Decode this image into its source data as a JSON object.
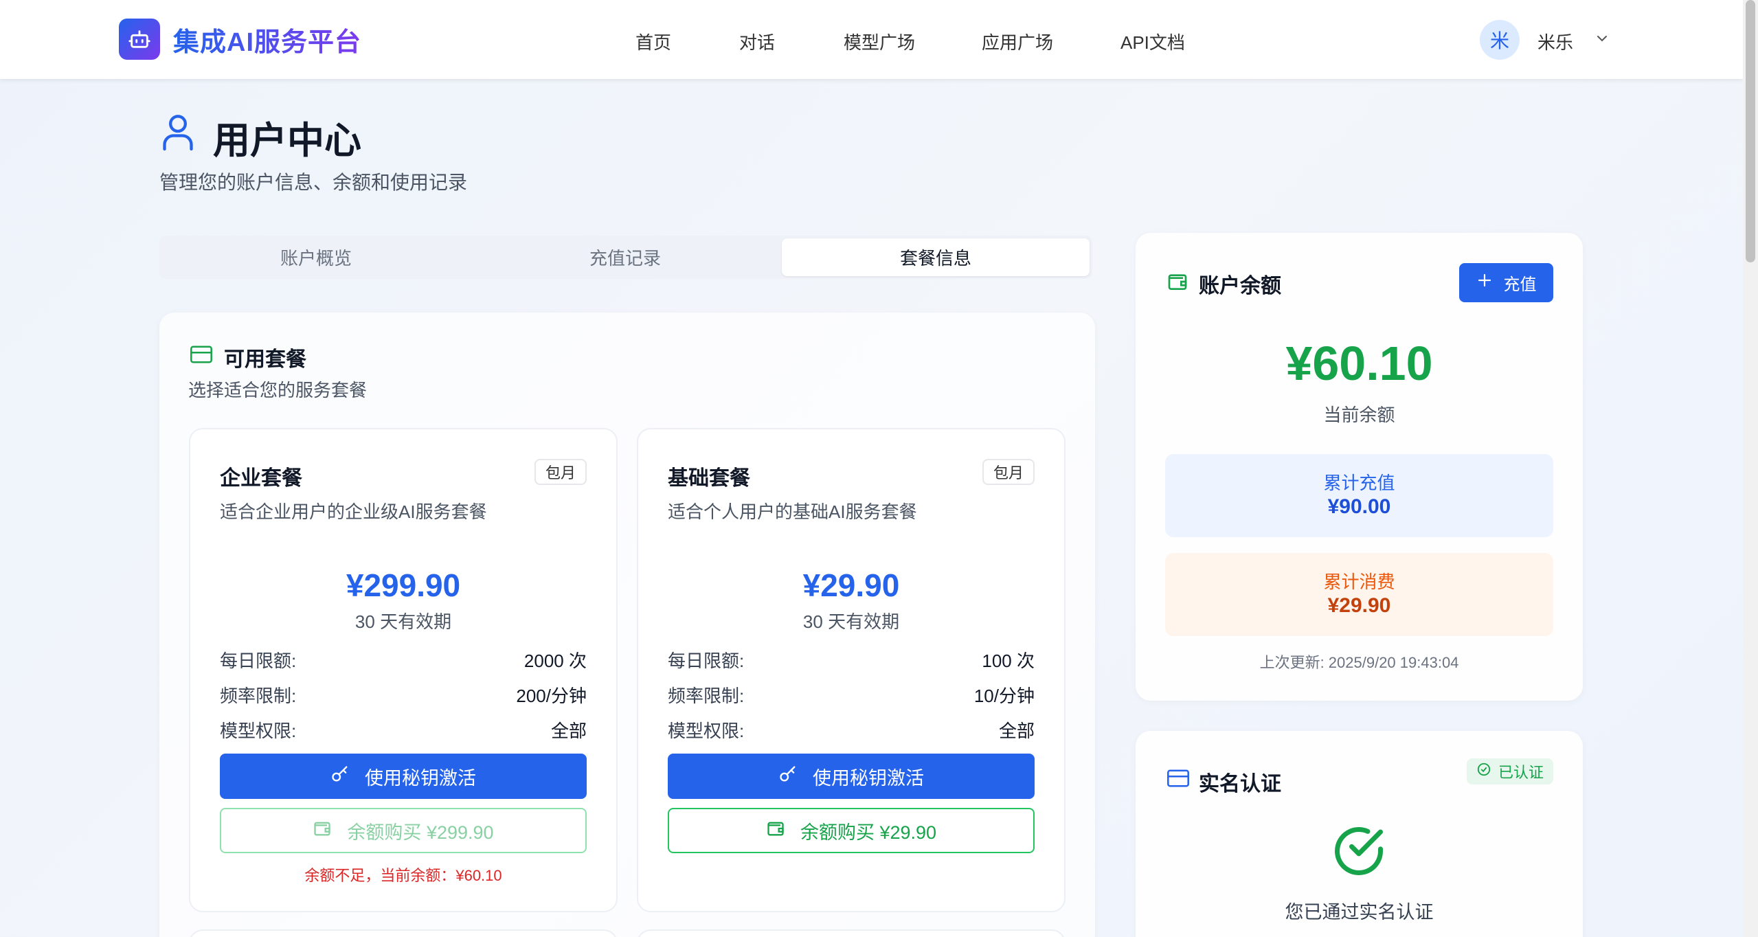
{
  "header": {
    "brand": "集成AI服务平台",
    "nav": [
      "首页",
      "对话",
      "模型广场",
      "应用广场",
      "API文档"
    ],
    "user_avatar_text": "米",
    "user_name": "米乐"
  },
  "page": {
    "title": "用户中心",
    "subtitle": "管理您的账户信息、余额和使用记录"
  },
  "tabs": [
    {
      "label": "账户概览",
      "active": false
    },
    {
      "label": "充值记录",
      "active": false
    },
    {
      "label": "套餐信息",
      "active": true
    }
  ],
  "plans_section": {
    "title": "可用套餐",
    "subtitle": "选择适合您的服务套餐",
    "plans": [
      {
        "name": "企业套餐",
        "badge": "包月",
        "description": "适合企业用户的企业级AI服务套餐",
        "price": "¥299.90",
        "validity": "30 天有效期",
        "rows": [
          {
            "label": "每日限额:",
            "value": "2000 次"
          },
          {
            "label": "频率限制:",
            "value": "200/分钟"
          },
          {
            "label": "模型权限:",
            "value": "全部"
          }
        ],
        "activate_label": "使用秘钥激活",
        "buy_label": "余额购买 ¥299.90",
        "buy_disabled": true,
        "warning": "余额不足，当前余额：¥60.10"
      },
      {
        "name": "基础套餐",
        "badge": "包月",
        "description": "适合个人用户的基础AI服务套餐",
        "price": "¥29.90",
        "validity": "30 天有效期",
        "rows": [
          {
            "label": "每日限额:",
            "value": "100 次"
          },
          {
            "label": "频率限制:",
            "value": "10/分钟"
          },
          {
            "label": "模型权限:",
            "value": "全部"
          }
        ],
        "activate_label": "使用秘钥激活",
        "buy_label": "余额购买 ¥29.90",
        "buy_disabled": false,
        "warning": ""
      }
    ]
  },
  "balance": {
    "title": "账户余额",
    "recharge_label": "充值",
    "amount": "¥60.10",
    "amount_label": "当前余额",
    "total_recharge_label": "累计充值",
    "total_recharge": "¥90.00",
    "total_spend_label": "累计消费",
    "total_spend": "¥29.90",
    "last_update": "上次更新: 2025/9/20 19:43:04"
  },
  "certification": {
    "title": "实名认证",
    "badge": "已认证",
    "message": "您已通过实名认证"
  },
  "colors": {
    "primary": "#2563eb",
    "success": "#16a34a",
    "warning": "#ea580c",
    "danger": "#dc2626"
  }
}
